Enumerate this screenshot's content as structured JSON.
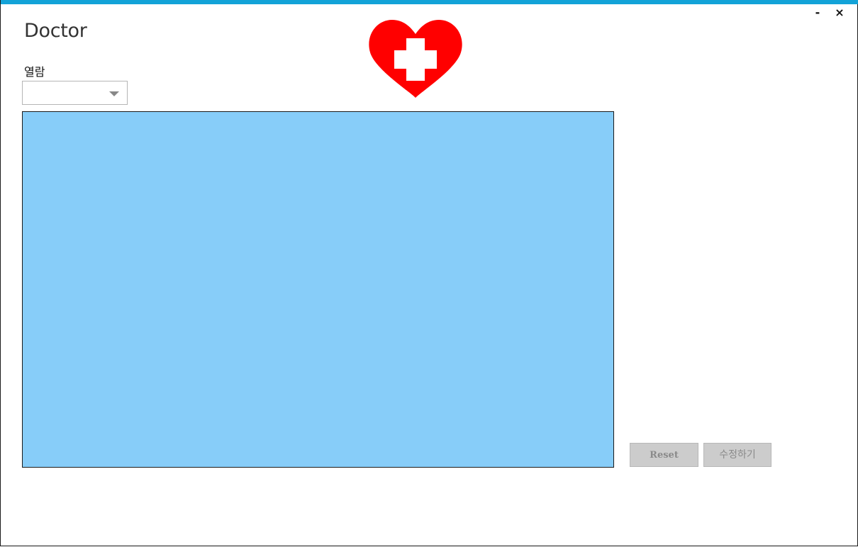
{
  "window": {
    "title": "Doctor",
    "minimize_label": "-",
    "close_label": "×",
    "accent_color": "#13a3d8"
  },
  "logo": {
    "icon": "medical-heart-cross-icon",
    "heart_color": "#ff0000",
    "cross_color": "#ffffff"
  },
  "filter": {
    "label": "열람",
    "selected_value": ""
  },
  "content": {
    "background_color": "#87cdf9"
  },
  "actions": {
    "reset_label": "Reset",
    "edit_label": "수정하기",
    "disabled": true
  }
}
